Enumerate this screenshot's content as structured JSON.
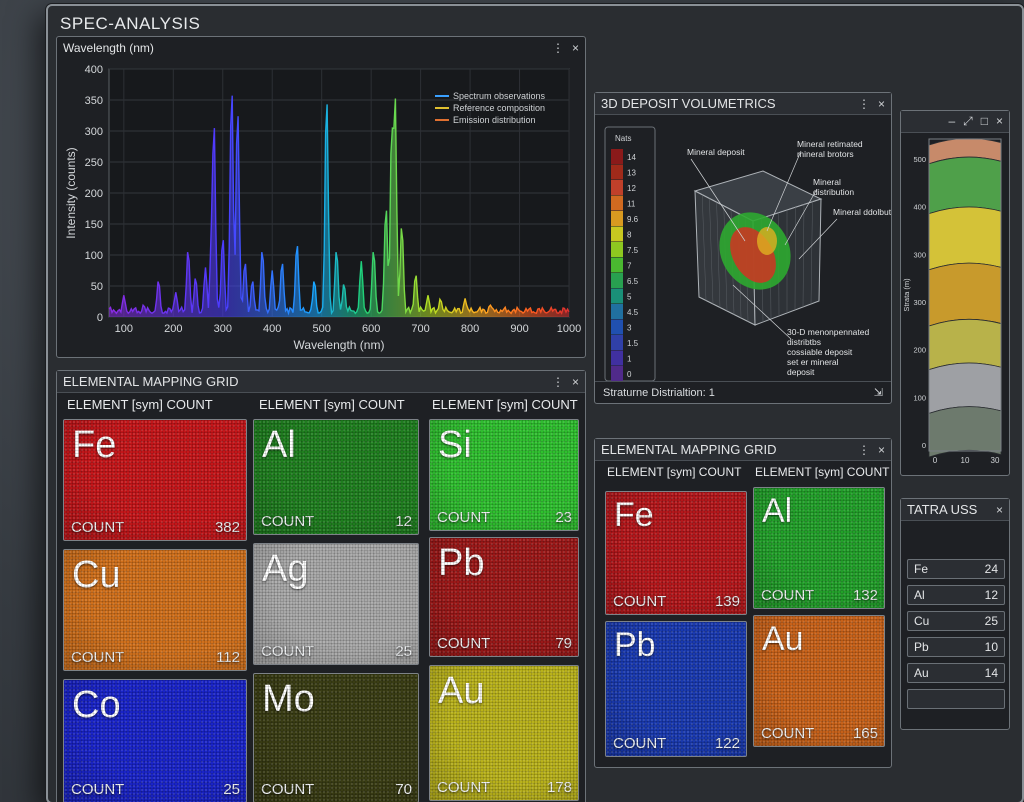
{
  "app": {
    "title": "SPEC-ANALYSIS"
  },
  "icons": {
    "more": "⋮",
    "close": "×",
    "minimize": "–",
    "restore": "⤢",
    "maximize": "□"
  },
  "spectrum": {
    "title": "Wavelength (nm)",
    "chart_data": {
      "type": "line",
      "xlabel": "Wavelength (nm)",
      "ylabel": "Intensity (counts)",
      "xlim": [
        70,
        1000
      ],
      "ylim": [
        0,
        400
      ],
      "xticks": [
        100,
        200,
        300,
        400,
        500,
        600,
        700,
        800,
        900,
        1000
      ],
      "yticks": [
        0,
        50,
        100,
        150,
        200,
        250,
        300,
        350,
        400
      ],
      "grid": true,
      "legend_position": "top-right",
      "legend": [
        "Spectrum observations",
        "Reference composition",
        "Emission distribution"
      ],
      "legend_colors": [
        "#3aa0ff",
        "#e0c030",
        "#e07030"
      ],
      "peaks": [
        {
          "x": 100,
          "y": 35
        },
        {
          "x": 140,
          "y": 20
        },
        {
          "x": 170,
          "y": 60
        },
        {
          "x": 205,
          "y": 40
        },
        {
          "x": 230,
          "y": 110
        },
        {
          "x": 245,
          "y": 65
        },
        {
          "x": 265,
          "y": 80
        },
        {
          "x": 278,
          "y": 160
        },
        {
          "x": 282,
          "y": 320
        },
        {
          "x": 300,
          "y": 130
        },
        {
          "x": 318,
          "y": 375
        },
        {
          "x": 330,
          "y": 340
        },
        {
          "x": 345,
          "y": 90
        },
        {
          "x": 360,
          "y": 60
        },
        {
          "x": 380,
          "y": 110
        },
        {
          "x": 400,
          "y": 75
        },
        {
          "x": 420,
          "y": 90
        },
        {
          "x": 450,
          "y": 120
        },
        {
          "x": 485,
          "y": 60
        },
        {
          "x": 510,
          "y": 360
        },
        {
          "x": 530,
          "y": 110
        },
        {
          "x": 545,
          "y": 55
        },
        {
          "x": 580,
          "y": 90
        },
        {
          "x": 605,
          "y": 110
        },
        {
          "x": 630,
          "y": 180
        },
        {
          "x": 642,
          "y": 320
        },
        {
          "x": 648,
          "y": 370
        },
        {
          "x": 662,
          "y": 150
        },
        {
          "x": 690,
          "y": 70
        },
        {
          "x": 715,
          "y": 35
        },
        {
          "x": 740,
          "y": 30
        },
        {
          "x": 790,
          "y": 30
        },
        {
          "x": 840,
          "y": 20
        },
        {
          "x": 900,
          "y": 10
        }
      ]
    }
  },
  "grid_main": {
    "title": "ELEMENTAL MAPPING GRID",
    "col_header": "ELEMENT [sym] COUNT",
    "count_label": "COUNT",
    "tiles": [
      {
        "sym": "Fe",
        "count": "382",
        "color": "#c4161a"
      },
      {
        "sym": "Al",
        "count": "12",
        "color": "#1f7f1f"
      },
      {
        "sym": "Si",
        "count": "23",
        "color": "#2fbf2f"
      },
      {
        "sym": "Cu",
        "count": "112",
        "color": "#d0701c"
      },
      {
        "sym": "Ag",
        "count": "25",
        "color": "#a8a8a8"
      },
      {
        "sym": "Pb",
        "count": "79",
        "color": "#9c1818"
      },
      {
        "sym": "Co",
        "count": "25",
        "color": "#1a24c8"
      },
      {
        "sym": "Mo",
        "count": "70",
        "color": "#3a3d14"
      },
      {
        "sym": "Au",
        "count": "178",
        "color": "#b9b21c"
      }
    ]
  },
  "deposit": {
    "title": "3D DEPOSIT VOLUMETRICS",
    "scale_title": "Nats",
    "scale_labels": [
      "14",
      "13",
      "12",
      "11",
      "9.6",
      "8",
      "7.5",
      "7",
      "6.5",
      "5",
      "4.5",
      "3",
      "1.5",
      "1",
      "0"
    ],
    "annotations": [
      "Mineral deposit",
      "Mineral retimated mineral brotors",
      "Mineral distribution",
      "Mineral ddolbution",
      "30-D menonpennated distribtbs cossiable deposit set er mineral deposit"
    ],
    "footer_label": "Straturne Distrialtion: 1",
    "footer_icon": "⇲"
  },
  "strata": {
    "ylabel": "Strata (m)",
    "yticks": [
      "500",
      "400",
      "300",
      "300",
      "200",
      "100",
      "0"
    ],
    "xticks": [
      "0",
      "10",
      "30"
    ]
  },
  "grid_side": {
    "title": "ELEMENTAL MAPPING GRID",
    "col_header": "ELEMENT [sym] COUNT",
    "count_label": "COUNT",
    "tiles": [
      {
        "sym": "Fe",
        "count": "139",
        "color": "#b4171b"
      },
      {
        "sym": "Al",
        "count": "132",
        "color": "#22a02a"
      },
      {
        "sym": "Pb",
        "count": "122",
        "color": "#1a3ab0"
      },
      {
        "sym": "Au",
        "count": "165",
        "color": "#c8621a"
      }
    ]
  },
  "table": {
    "title": "TATRA USS",
    "rows": [
      {
        "label": "Fe",
        "value": "24"
      },
      {
        "label": "Al",
        "value": "12"
      },
      {
        "label": "Cu",
        "value": "25"
      },
      {
        "label": "Pb",
        "value": "10"
      },
      {
        "label": "Au",
        "value": "14"
      }
    ]
  }
}
